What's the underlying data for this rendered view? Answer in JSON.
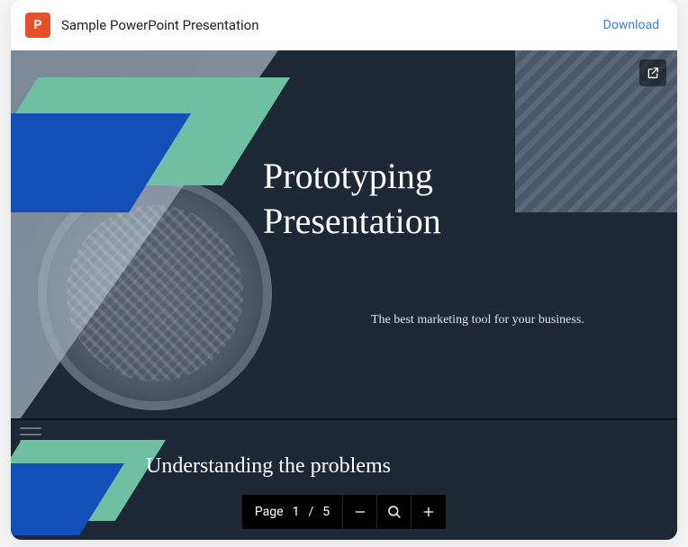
{
  "header": {
    "file_title": "Sample PowerPoint Presentation",
    "download_label": "Download",
    "icon_letter": "P"
  },
  "slide1": {
    "title_line1": "Prototyping",
    "title_line2": "Presentation",
    "subtitle": "The best marketing tool for your business."
  },
  "slide2": {
    "title": "Understanding the problems"
  },
  "pager": {
    "page_label": "Page",
    "current": "1",
    "separator": "/",
    "total": "5"
  }
}
